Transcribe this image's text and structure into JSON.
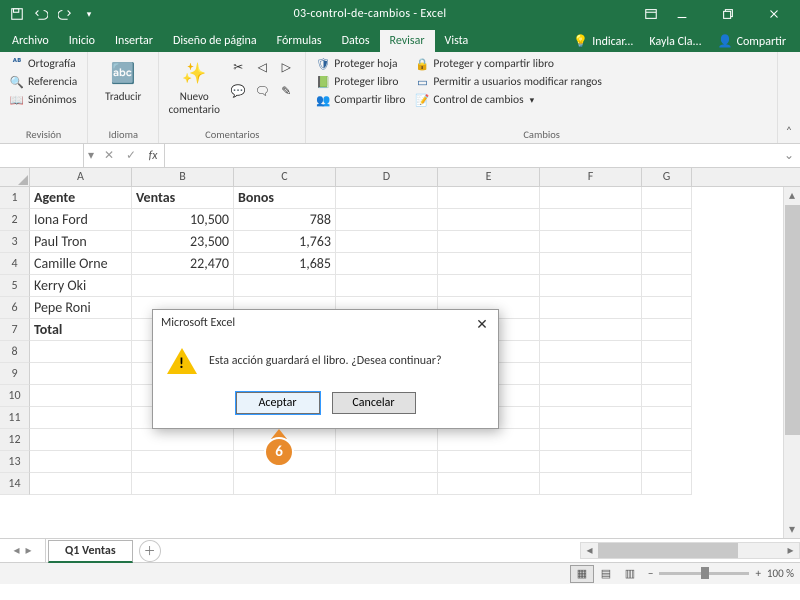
{
  "title": "03-control-de-cambios  -  Excel",
  "qat": {
    "save": "save-icon",
    "undo": "undo-icon",
    "redo": "redo-icon",
    "customize": "customize-icon"
  },
  "tabs": {
    "items": [
      "Archivo",
      "Inicio",
      "Insertar",
      "Diseño de página",
      "Fórmulas",
      "Datos",
      "Revisar",
      "Vista"
    ],
    "active": 6,
    "tellme": "Indicar...",
    "user": "Kayla Cla...",
    "share": "Compartir"
  },
  "ribbon": {
    "groups": {
      "revision": {
        "label": "Revisión",
        "items": [
          "Ortografía",
          "Referencia",
          "Sinónimos"
        ]
      },
      "idioma": {
        "label": "Idioma",
        "btn": "Traducir"
      },
      "comentarios": {
        "label": "Comentarios",
        "btn": "Nuevo comentario"
      },
      "cambios": {
        "label": "Cambios",
        "col1": [
          "Proteger hoja",
          "Proteger libro",
          "Compartir libro"
        ],
        "col2": [
          "Proteger y compartir libro",
          "Permitir a usuarios modificar rangos",
          "Control de cambios"
        ]
      }
    }
  },
  "formula": {
    "name": "",
    "fx": "fx",
    "value": ""
  },
  "grid": {
    "cols": [
      "A",
      "B",
      "C",
      "D",
      "E",
      "F",
      "G"
    ],
    "rows": [
      1,
      2,
      3,
      4,
      5,
      6,
      7,
      8,
      9,
      10,
      11,
      12,
      13,
      14
    ],
    "data": [
      {
        "A": "Agente",
        "B": "Ventas",
        "C": "Bonos",
        "bold": true
      },
      {
        "A": "Iona Ford",
        "Bnum": "10,500",
        "Cnum": "788"
      },
      {
        "A": "Paul Tron",
        "Bnum": "23,500",
        "Cnum": "1,763"
      },
      {
        "A": "Camille  Orne",
        "Bnum": "22,470",
        "Cnum": "1,685"
      },
      {
        "A": "Kerry Oki"
      },
      {
        "A": "Pepe Roni"
      },
      {
        "A": "Total",
        "bold": true
      }
    ]
  },
  "sheet": {
    "name": "Q1 Ventas"
  },
  "status": {
    "zoom": "100 %"
  },
  "dialog": {
    "title": "Microsoft Excel",
    "message": "Esta acción guardará el libro. ¿Desea continuar?",
    "ok": "Aceptar",
    "cancel": "Cancelar"
  },
  "callout": "6"
}
